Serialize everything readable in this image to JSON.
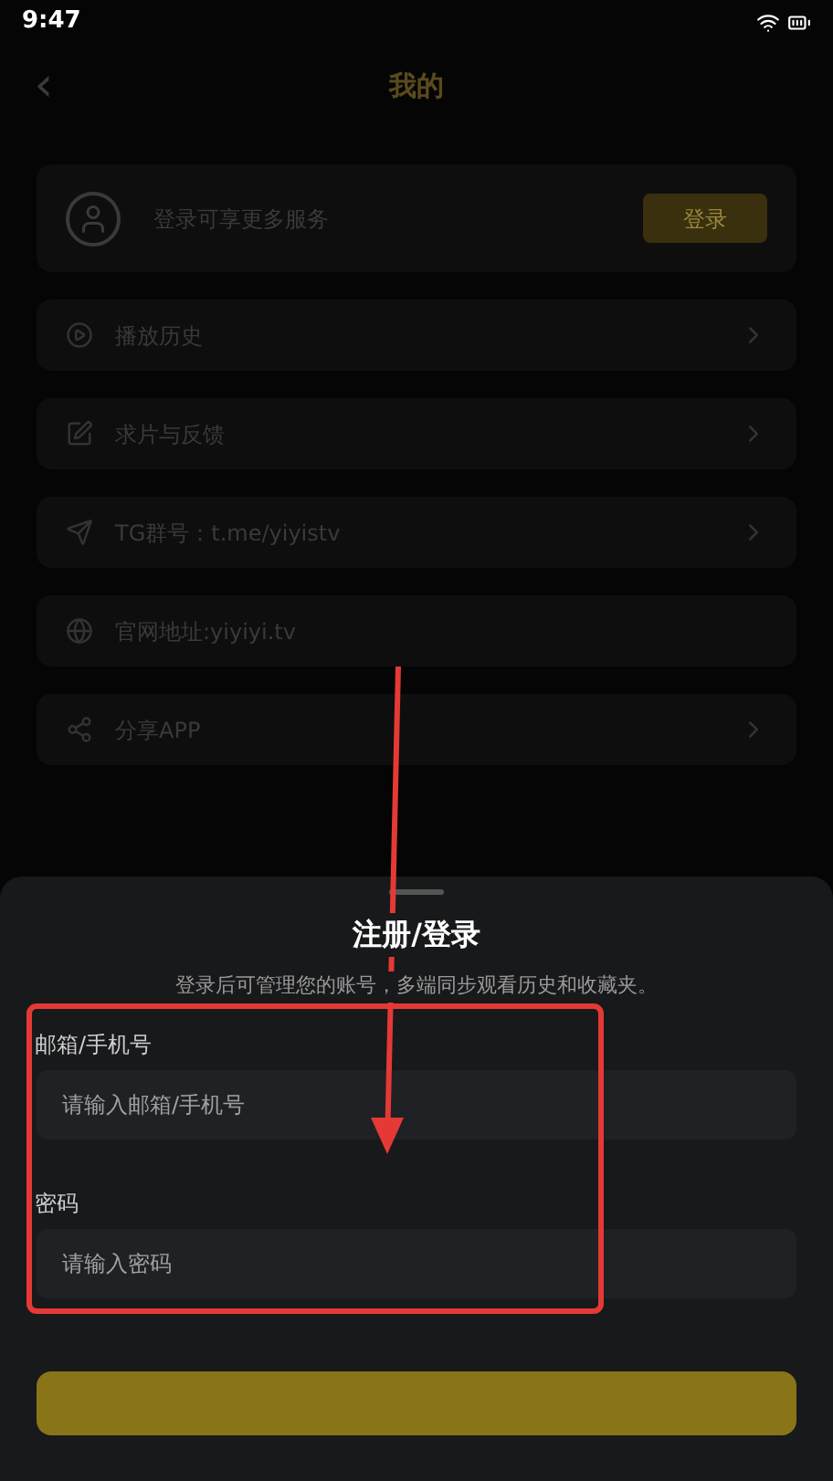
{
  "status_bar": {
    "time": "9:47"
  },
  "header": {
    "back": "‹",
    "title": "我的"
  },
  "profile": {
    "prompt": "登录可享更多服务",
    "login_button": "登录"
  },
  "menu": [
    {
      "label": "播放历史",
      "chevron": true
    },
    {
      "label": "求片与反馈",
      "chevron": true
    },
    {
      "label": "TG群号：t.me/yiyistv",
      "chevron": true
    },
    {
      "label": "官网地址:yiyiyi.tv",
      "chevron": false
    },
    {
      "label": "分享APP",
      "chevron": true
    }
  ],
  "sheet": {
    "title": "注册/登录",
    "subtitle": "登录后可管理您的账号，多端同步观看历史和收藏夹。",
    "fields": [
      {
        "label": "邮箱/手机号",
        "placeholder": "请输入邮箱/手机号"
      },
      {
        "label": "密码",
        "placeholder": "请输入密码"
      }
    ]
  }
}
